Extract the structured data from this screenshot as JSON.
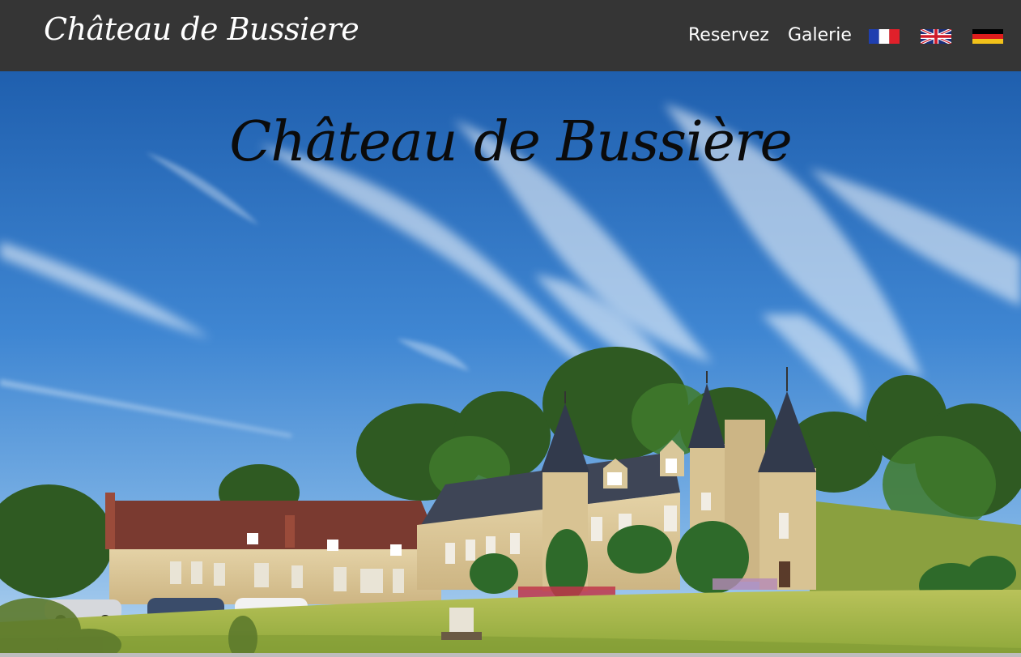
{
  "navbar": {
    "brand": "Château de Bussiere",
    "links": [
      {
        "label": "Reservez"
      },
      {
        "label": "Galerie"
      }
    ],
    "languages": [
      {
        "code": "fr",
        "icon": "france-flag-icon"
      },
      {
        "code": "en",
        "icon": "uk-flag-icon"
      },
      {
        "code": "de",
        "icon": "germany-flag-icon"
      }
    ]
  },
  "hero": {
    "title": "Château de Bussière",
    "image": "chateau-photo"
  },
  "colors": {
    "navbar_bg": "#353535",
    "nav_text": "#ffffff",
    "title_text": "#0b0b0b"
  }
}
